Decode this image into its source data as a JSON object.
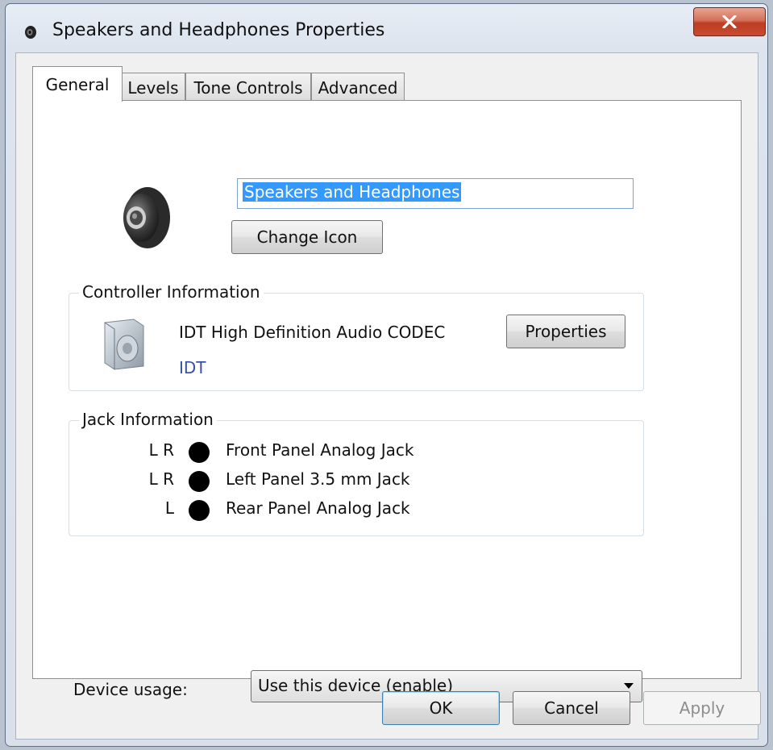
{
  "window": {
    "title": "Speakers and Headphones Properties",
    "icon": "speaker-icon"
  },
  "tabs": [
    {
      "label": "General",
      "active": true
    },
    {
      "label": "Levels",
      "active": false
    },
    {
      "label": "Tone Controls",
      "active": false
    },
    {
      "label": "Advanced",
      "active": false
    }
  ],
  "general": {
    "device_name": "Speakers and Headphones",
    "change_icon_label": "Change Icon",
    "controller": {
      "legend": "Controller Information",
      "name": "IDT High Definition Audio CODEC",
      "vendor": "IDT",
      "properties_label": "Properties"
    },
    "jack": {
      "legend": "Jack Information",
      "items": [
        {
          "channels": "L R",
          "label": "Front Panel Analog Jack",
          "color": "#000000"
        },
        {
          "channels": "L R",
          "label": "Left Panel 3.5 mm Jack",
          "color": "#000000"
        },
        {
          "channels": "L",
          "label": "Rear Panel Analog Jack",
          "color": "#000000"
        }
      ]
    },
    "device_usage": {
      "label": "Device usage:",
      "selected": "Use this device (enable)"
    }
  },
  "footer": {
    "ok": "OK",
    "cancel": "Cancel",
    "apply": "Apply"
  },
  "colors": {
    "selection": "#3399ff",
    "vendor_link": "#3a4fa8",
    "close_button": "#c84a30"
  }
}
